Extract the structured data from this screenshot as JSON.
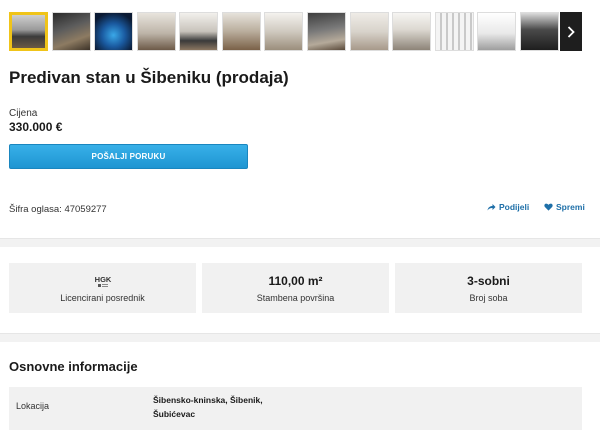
{
  "listing": {
    "title": "Predivan stan u Šibeniku (prodaja)",
    "price_label": "Cijena",
    "price_value": "330.000 €",
    "send_button": "POŠALJI PORUKU",
    "ad_code": "Šifra oglasa: 47059277",
    "share_label": "Podijeli",
    "save_label": "Spremi"
  },
  "gallery": {
    "next_icon": "chevron-right-icon",
    "thumbnails": 13,
    "active_index": 0
  },
  "highlights": {
    "agent_logo_text": "HGK",
    "agent_label": "Licencirani posrednik",
    "area_value": "110,00 m²",
    "area_label": "Stambena površina",
    "rooms_value": "3-sobni",
    "rooms_label": "Broj soba"
  },
  "basic_info": {
    "title": "Osnovne informacije",
    "rows": [
      {
        "key": "Lokacija",
        "value_line1": "Šibensko-kninska, Šibenik,",
        "value_line2": "Šubićevac"
      }
    ]
  },
  "colors": {
    "accent": "#1e95d2",
    "active_thumb_border": "#f0c419",
    "link": "#1e6fa8"
  }
}
